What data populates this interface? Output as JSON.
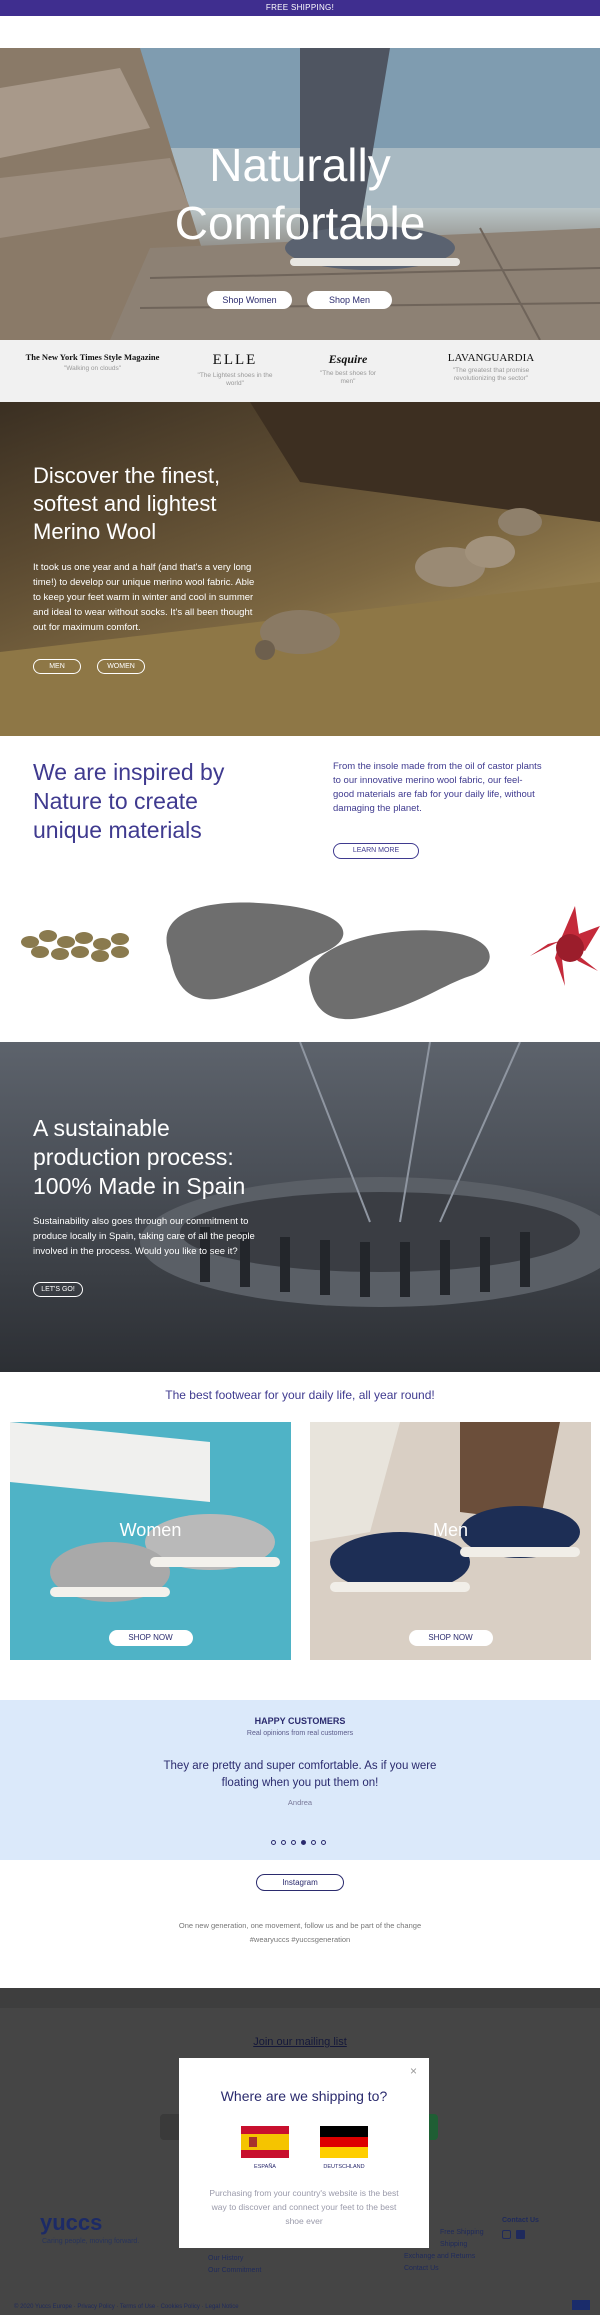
{
  "topbar": {
    "text": "FREE SHIPPING!"
  },
  "hero": {
    "title_line1": "Naturally",
    "title_line2": "Comfortable",
    "btn_women": "Shop Women",
    "btn_men": "Shop Men"
  },
  "press": [
    {
      "logo": "The New York Times Style Magazine",
      "quote": "\"Walking on clouds\""
    },
    {
      "logo": "ELLE",
      "quote": "\"The Lightest shoes in the world\""
    },
    {
      "logo": "Esquire",
      "quote": "\"The best shoes for men\""
    },
    {
      "logo": "LAVANGUARDIA",
      "quote": "\"The greatest that promise revolutionizing the sector\""
    }
  ],
  "merino": {
    "title_lines": [
      "Discover the finest,",
      "softest and lightest",
      "Merino Wool"
    ],
    "body_lines": [
      "It took us one year and a half (and that's a very long",
      "time!) to develop our unique merino wool fabric. Able",
      "to keep your feet warm in winter and cool in summer",
      "and ideal to wear without socks. It's all been thought",
      "out for maximum comfort."
    ],
    "btn_men": "MEN",
    "btn_women": "WOMEN"
  },
  "inspired": {
    "title_lines": [
      "We are inspired by",
      "Nature to create",
      "unique materials"
    ],
    "body_lines": [
      "From the insole made from the oil of castor plants",
      "to our innovative merino wool fabric, our feel-",
      "good materials are fab for your daily life, without",
      "damaging the planet."
    ],
    "btn": "LEARN MORE"
  },
  "production": {
    "title_lines": [
      "A sustainable",
      "production process:",
      "100% Made in Spain"
    ],
    "body_lines": [
      "Sustainability also goes through our commitment to",
      "produce locally in Spain, taking care of all the people",
      "involved in the process. Would you like to see it?"
    ],
    "btn": "LET'S GO!"
  },
  "daily": {
    "title": "The best footwear for your daily life, all year round!",
    "cards": [
      {
        "label": "Women",
        "btn": "SHOP NOW"
      },
      {
        "label": "Men",
        "btn": "SHOP NOW"
      }
    ]
  },
  "reviews": {
    "heading": "HAPPY CUSTOMERS",
    "subheading": "Real opinions from real customers",
    "quote_line1": "They are pretty and super comfortable. As if you were",
    "quote_line2": "floating when you put them on!",
    "author": "Andrea",
    "dots_total": 6,
    "dots_active": 4
  },
  "instagram": {
    "btn": "Instagram",
    "line1": "One new generation, one movement, follow us and be part of the change",
    "line2": "#wearyuccs #yuccsgeneration"
  },
  "footer": {
    "mailing": "Join our mailing list",
    "brand": "yuccs",
    "tagline": "Caring people, moving forward.",
    "col1": [
      "Our History",
      "Our Commitment"
    ],
    "col2": [
      "Shipping",
      "Exchange and Returns",
      "Contact Us"
    ],
    "col2_first": "Free Shipping",
    "contact_heading": "Contact Us",
    "bottom": "© 2020 Yuccs Europe · Privacy Policy · Terms of Use · Cookies Policy · Legal Notice"
  },
  "modal": {
    "title": "Where are we shipping to?",
    "countries": [
      "ESPAÑA",
      "DEUTSCHLAND"
    ],
    "text_lines": [
      "Purchasing from your country's website is the best",
      "way to discover and connect your feet to the best",
      "shoe ever"
    ]
  },
  "colors": {
    "brand": "#3f2e8f",
    "text_blue": "#3f3a8f",
    "review_bg": "#dbe9fa",
    "footer_bg": "#454545"
  }
}
